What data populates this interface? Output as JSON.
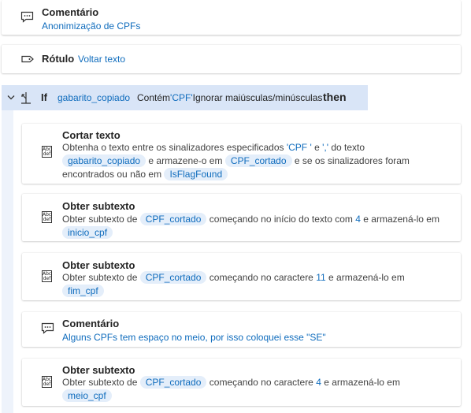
{
  "top_comment": {
    "title": "Comentário",
    "text": "Anonimização de CPFs"
  },
  "label_step": {
    "title": "Rótulo",
    "text": "Voltar texto"
  },
  "if_step": {
    "keyword": "If",
    "variable": "gabarito_copiado",
    "condition_prefix": "Contém",
    "condition_value": "'CPF'",
    "condition_suffix": "Ignorar maiúsculas/minúsculas",
    "then_label": "then"
  },
  "cut_text": {
    "title": "Cortar texto",
    "p1": "Obtenha o texto entre os sinalizadores especificados ",
    "flag1": "'CPF '",
    "p2": " e ",
    "flag2": "','",
    "p3": " do texto",
    "var1": "gabarito_copiado",
    "p4": "e armazene-o em",
    "var2": "CPF_cortado",
    "p5": "e se os sinalizadores foram",
    "p6": "encontrados ou não em",
    "var3": "IsFlagFound"
  },
  "substr1": {
    "title": "Obter subtexto",
    "p1": "Obter subtexto de",
    "var1": "CPF_cortado",
    "p2": "começando no início do texto com",
    "num": "4",
    "p3": "e armazená-lo em",
    "var2": "inicio_cpf"
  },
  "substr2": {
    "title": "Obter subtexto",
    "p1": "Obter subtexto de",
    "var1": "CPF_cortado",
    "p2": "começando no caractere",
    "num": "11",
    "p3": "e armazená-lo em",
    "var2": "fim_cpf"
  },
  "comment2": {
    "title": "Comentário",
    "text": "Alguns CPFs tem espaço no meio, por isso coloquei esse \"SE\""
  },
  "substr3": {
    "title": "Obter subtexto",
    "p1": "Obter subtexto de",
    "var1": "CPF_cortado",
    "p2": "começando no caractere",
    "num": "4",
    "p3": "e armazená-lo em",
    "var2": "meio_cpf"
  },
  "icon_text": {
    "abc": "Abc",
    "def": "def"
  }
}
